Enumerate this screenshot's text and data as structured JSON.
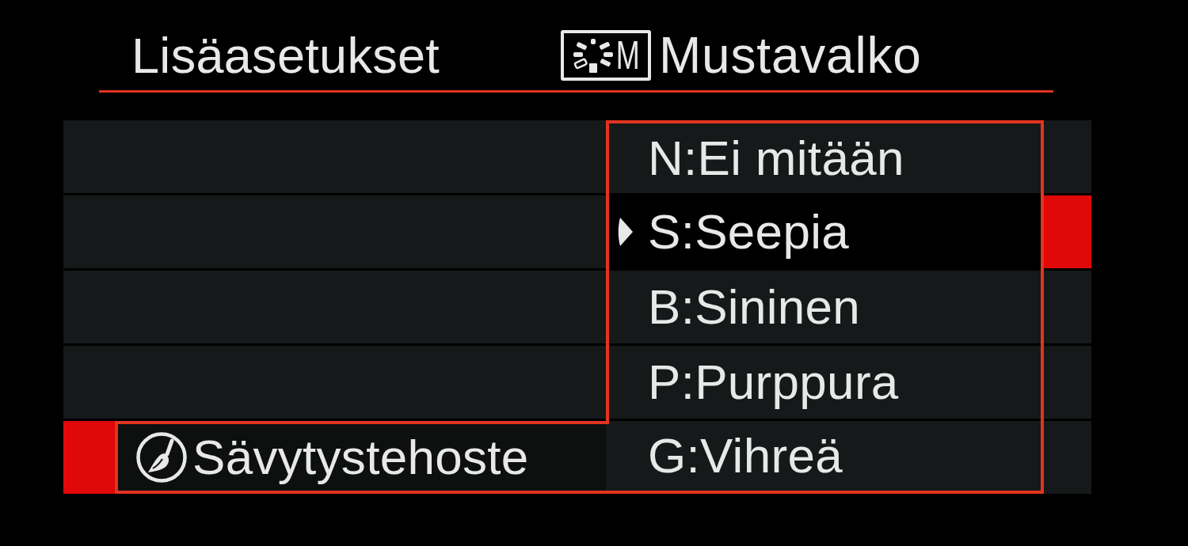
{
  "header": {
    "title": "Lisäasetukset",
    "style_badge": {
      "letter": "M"
    },
    "style_name": "Mustavalko"
  },
  "menu": {
    "items": [
      {
        "kind": "blank",
        "selected": false
      },
      {
        "kind": "blank",
        "selected": false
      },
      {
        "kind": "blank",
        "selected": false
      },
      {
        "kind": "blank",
        "selected": false
      },
      {
        "kind": "setting",
        "label": "Sävytystehoste",
        "selected": true
      }
    ]
  },
  "dropdown": {
    "options": [
      {
        "label": "N:Ei mitään",
        "selected": false,
        "current": false
      },
      {
        "label": "S:Seepia",
        "selected": true,
        "current": true
      },
      {
        "label": "B:Sininen",
        "selected": false,
        "current": false
      },
      {
        "label": "P:Purppura",
        "selected": false,
        "current": false
      },
      {
        "label": "G:Vihreä",
        "selected": false,
        "current": false
      }
    ]
  }
}
